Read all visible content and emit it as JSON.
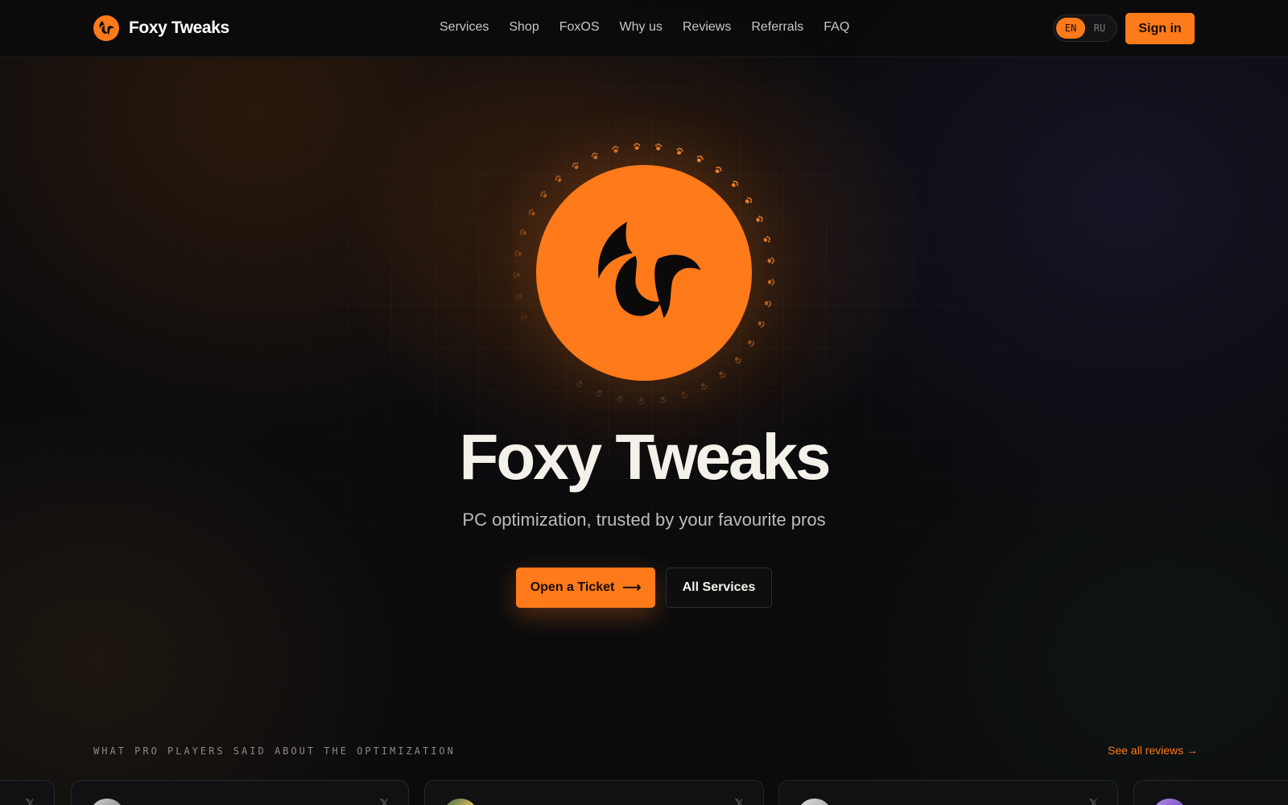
{
  "header": {
    "brand": "Foxy Tweaks",
    "nav": [
      "Services",
      "Shop",
      "FoxOS",
      "Why us",
      "Reviews",
      "Referrals",
      "FAQ"
    ],
    "lang_options": [
      "EN",
      "RU"
    ],
    "lang_active": "EN",
    "sign_in": "Sign in"
  },
  "hero": {
    "title": "Foxy Tweaks",
    "subtitle": "PC optimization, trusted by your favourite pros",
    "primary_button": "Open a Ticket",
    "primary_arrow": "⟶",
    "secondary_button": "All Services"
  },
  "reviews": {
    "section_label": "WHAT PRO PLAYERS SAID ABOUT THE OPTIMIZATION",
    "see_all": "See all reviews →",
    "card_icon": "𝕏"
  },
  "colors": {
    "accent": "#ff7a1a",
    "background": "#0b0b0d",
    "text": "#f4f1ea"
  }
}
